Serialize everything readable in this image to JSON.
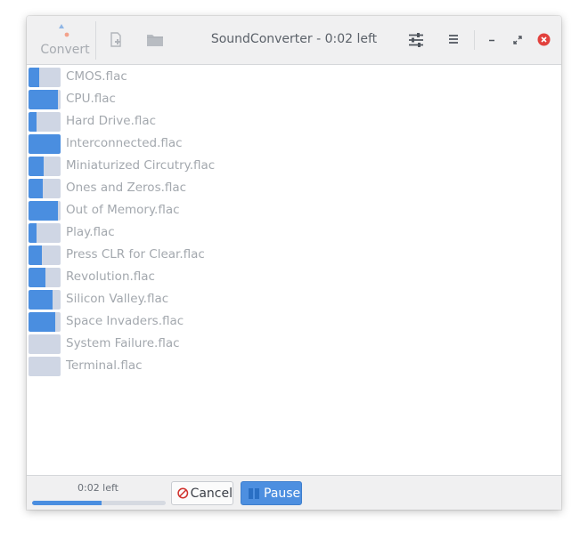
{
  "window": {
    "title": "SoundConverter - 0:02 left"
  },
  "toolbar": {
    "convert_label": "Convert",
    "icons": [
      "convert-icon",
      "add-file-icon",
      "add-folder-icon",
      "preferences-icon",
      "menu-icon"
    ]
  },
  "window_controls": [
    "minimize-icon",
    "maximize-icon",
    "close-icon"
  ],
  "files": [
    {
      "name": "CMOS.flac",
      "progress": 0.33
    },
    {
      "name": "CPU.flac",
      "progress": 0.92
    },
    {
      "name": "Hard Drive.flac",
      "progress": 0.25
    },
    {
      "name": "Interconnected.flac",
      "progress": 1.0
    },
    {
      "name": "Miniaturized Circutry.flac",
      "progress": 0.47
    },
    {
      "name": "Ones and Zeros.flac",
      "progress": 0.44
    },
    {
      "name": "Out of Memory.flac",
      "progress": 0.92
    },
    {
      "name": "Play.flac",
      "progress": 0.25
    },
    {
      "name": "Press CLR for Clear.flac",
      "progress": 0.42
    },
    {
      "name": "Revolution.flac",
      "progress": 0.53
    },
    {
      "name": "Silicon Valley.flac",
      "progress": 0.75
    },
    {
      "name": "Space Invaders.flac",
      "progress": 0.83
    },
    {
      "name": "System Failure.flac",
      "progress": 0.0
    },
    {
      "name": "Terminal.flac",
      "progress": 0.0
    }
  ],
  "footer": {
    "time_left": "0:02 left",
    "overall_progress": 0.52,
    "cancel_label": "Cancel",
    "pause_label": "Pause"
  },
  "colors": {
    "accent": "#4a8ee0",
    "track": "#cfd6e4",
    "close": "#e2413d"
  }
}
